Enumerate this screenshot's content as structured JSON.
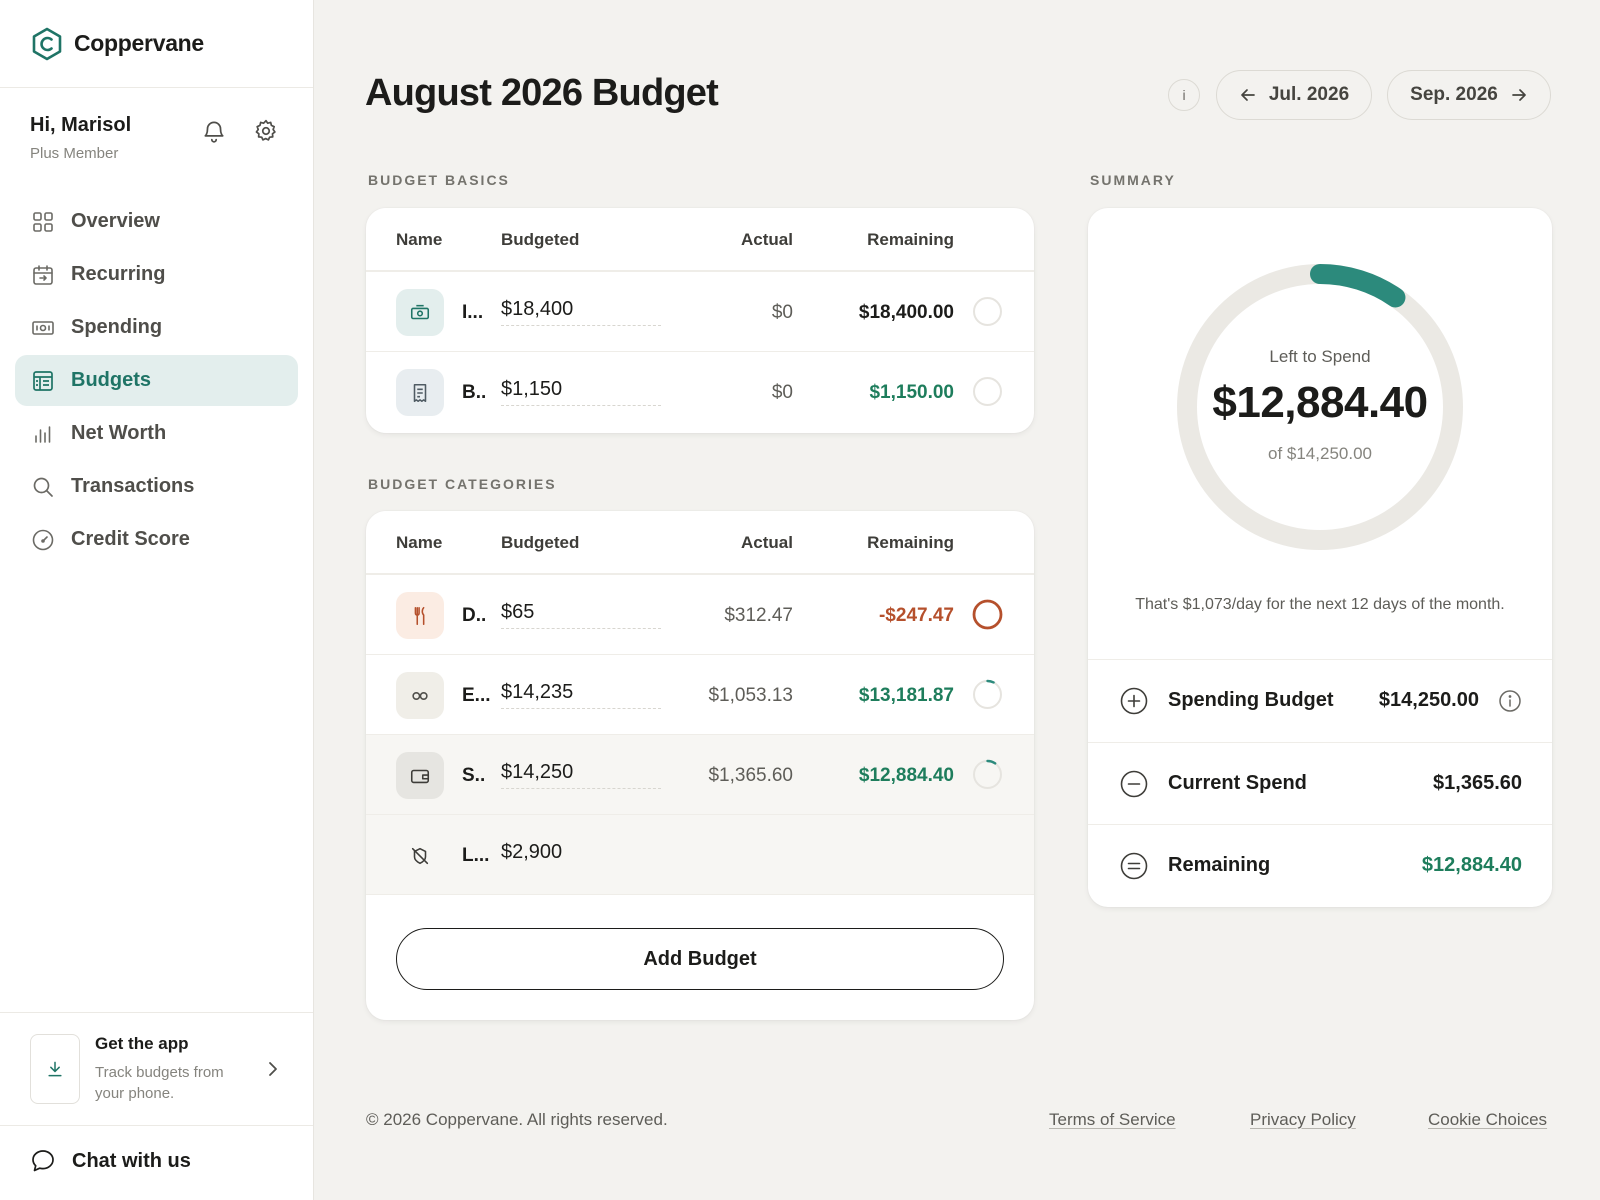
{
  "brand": {
    "name": "Coppervane"
  },
  "user": {
    "greeting": "Hi, Marisol",
    "tier": "Plus Member"
  },
  "nav": [
    {
      "label": "Overview",
      "icon": "grid-icon",
      "active": false
    },
    {
      "label": "Recurring",
      "icon": "calendar-repeat-icon",
      "active": false
    },
    {
      "label": "Spending",
      "icon": "cash-icon",
      "active": false
    },
    {
      "label": "Budgets",
      "icon": "budget-sheet-icon",
      "active": true
    },
    {
      "label": "Net Worth",
      "icon": "bar-chart-icon",
      "active": false
    },
    {
      "label": "Transactions",
      "icon": "search-icon",
      "active": false
    },
    {
      "label": "Credit Score",
      "icon": "gauge-icon",
      "active": false
    }
  ],
  "promo": {
    "title": "Get the app",
    "subtitle": "Track budgets from your phone."
  },
  "chat": {
    "label": "Chat with us"
  },
  "header": {
    "title": "August 2026 Budget",
    "info_label": "i",
    "prev_month": "Jul. 2026",
    "next_month": "Sep. 2026"
  },
  "basics": {
    "section_label": "BUDGET BASICS",
    "columns": {
      "name": "Name",
      "budgeted": "Budgeted",
      "actual": "Actual",
      "remaining": "Remaining"
    },
    "rows": [
      {
        "name": "I...",
        "budgeted": "$18,400",
        "actual": "$0",
        "remaining": "$18,400.00",
        "remaining_color": "#1c1c1a",
        "icon": "cash-icon",
        "progress": 0
      },
      {
        "name": "B..",
        "budgeted": "$1,150",
        "actual": "$0",
        "remaining": "$1,150.00",
        "remaining_color": "#1e7d5c",
        "icon": "receipt-icon",
        "progress": 0
      }
    ]
  },
  "categories": {
    "section_label": "BUDGET CATEGORIES",
    "columns": {
      "name": "Name",
      "budgeted": "Budgeted",
      "actual": "Actual",
      "remaining": "Remaining"
    },
    "rows": [
      {
        "name": "D..",
        "budgeted": "$65",
        "actual": "$312.47",
        "remaining": "-$247.47",
        "remaining_color": "#b5502c",
        "icon": "utensils-icon",
        "progress": 1.0
      },
      {
        "name": "E...",
        "budgeted": "$14,235",
        "actual": "$1,053.13",
        "remaining": "$13,181.87",
        "remaining_color": "#1e7d5c",
        "icon": "infinity-icon",
        "progress": 0.074
      },
      {
        "name": "S..",
        "budgeted": "$14,250",
        "actual": "$1,365.60",
        "remaining": "$12,884.40",
        "remaining_color": "#1e7d5c",
        "icon": "wallet-icon",
        "progress": 0.096
      },
      {
        "name": "L...",
        "budgeted": "$2,900",
        "actual": "",
        "remaining": "",
        "icon": "eye-off-tag-icon"
      }
    ],
    "add_label": "Add Budget"
  },
  "summary": {
    "section_label": "SUMMARY",
    "donut_title": "Left to Spend",
    "donut_value": "$12,884.40",
    "donut_sub": "of $14,250.00",
    "donut_progress": 0.096,
    "daily_note": "That's $1,073/day for the next 12 days of the month.",
    "rows": [
      {
        "label": "Spending Budget",
        "value": "$14,250.00",
        "symbol": "plus-circle-icon"
      },
      {
        "label": "Current Spend",
        "value": "$1,365.60",
        "symbol": "minus-circle-icon"
      },
      {
        "label": "Remaining",
        "value": "$12,884.40",
        "symbol": "equals-circle-icon"
      }
    ]
  },
  "footer": {
    "copyright": "© 2026 Coppervane. All rights reserved.",
    "links": [
      "Terms of Service",
      "Privacy Policy",
      "Cookie Choices"
    ]
  },
  "colors": {
    "accent": "#2c8a7c",
    "positive": "#1e7d5c",
    "negative": "#b5502c",
    "track": "#ebe9e4"
  }
}
